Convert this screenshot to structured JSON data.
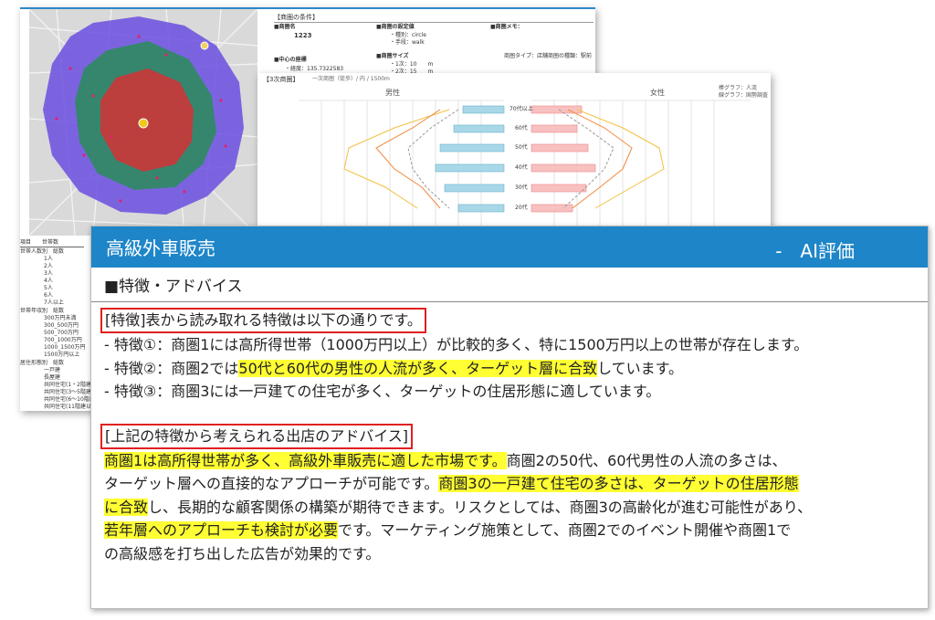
{
  "back_sheet": {
    "conditions_title": "【商圏の条件】",
    "trade_area_name_label": "■商圏名",
    "trade_area_name_value": "1223",
    "settings_label": "■商圏の設定値",
    "settings_shape": "・種別：circle",
    "settings_means": "・手段：walk",
    "memo_label": "■商圏メモ：",
    "center_label": "■中心の座標",
    "center_lon": "・経度：135.7322583",
    "size_label": "■商圏サイズ",
    "size_1": "・1次：10　　m",
    "size_2": "・2次：15　　m",
    "shop_type": "商圏タイプ：店舗商圏の種類：駅前",
    "left_table": {
      "header": "項目　　世帯数",
      "group1": "世帯人数別　総数",
      "rows1": [
        "1人",
        "2人",
        "3人",
        "4人",
        "5人",
        "6人",
        "7人以上"
      ],
      "group2": "世帯年収別　総数",
      "rows2": [
        "300万円未満",
        "300_500万円",
        "500_700万円",
        "700_1000万円",
        "1000_1500万円",
        "1500万円以上"
      ],
      "group3": "居住形態別　総数",
      "rows3": [
        "一戸建",
        "長屋建",
        "共同住宅(1・2階建)",
        "共同住宅(3～5階建)",
        "共同住宅(6～10階建)",
        "共同住宅(11階建以上)"
      ]
    }
  },
  "mid_sheet": {
    "title": "【3次商圏】",
    "subtitle": "一次商圏（徒歩）/ 内 / 1500m",
    "male": "男性",
    "female": "女性",
    "legend": [
      "棒グラフ：人流",
      "線グラフ：国勢調査"
    ],
    "age_labels": [
      "70代以上",
      "60代",
      "50代",
      "40代",
      "30代",
      "20代"
    ]
  },
  "panel": {
    "title": "高級外車販売",
    "subtitle": "-　AI評価",
    "section": "■特徴・アドバイス",
    "features_heading": "[特徴]表から読み取れる特徴は以下の通りです。",
    "feature1": "- 特徴①：商圏1には高所得世帯（1000万円以上）が比較的多く、特に1500万円以上の世帯が存在します。",
    "feature2_pre": "- 特徴②：商圏2では",
    "feature2_hl": "50代と60代の男性の人流が多く、ターゲット層に合致",
    "feature2_post": "しています。",
    "feature3": "- 特徴③：商圏3には一戸建ての住宅が多く、ターゲットの住居形態に適しています。",
    "advice_heading": "[上記の特徴から考えられる出店のアドバイス]",
    "advice_l1_hl": "商圏1は高所得世帯が多く、高級外車販売に適した市場です。",
    "advice_l1_post": "商圏2の50代、60代男性の人流の多さは、",
    "advice_l2_pre": "ターゲット層への直接的なアプローチが可能です。",
    "advice_l2_hl": "商圏3の一戸建て住宅の多さは、ターゲットの住居形態",
    "advice_l3_hl": "に合致",
    "advice_l3_post": "し、長期的な顧客関係の構築が期待できます。リスクとしては、商圏3の高齢化が進む可能性があり、",
    "advice_l4_hl": "若年層へのアプローチも検討が必要",
    "advice_l4_post": "です。マーケティング施策として、商圏2でのイベント開催や商圏1で",
    "advice_l5": "の高級感を打ち出した広告が効果的です。"
  },
  "colors": {
    "header_blue": "#1e86c8",
    "highlight_yellow": "#ffff33",
    "box_red": "#e02020",
    "zone1": "#c43a3a",
    "zone2": "#2f8a62",
    "zone3": "#6a4ee0"
  }
}
